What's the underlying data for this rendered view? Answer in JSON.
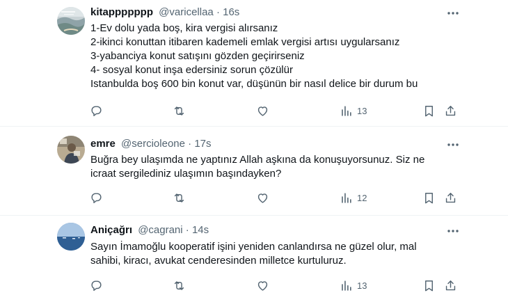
{
  "tweets": [
    {
      "name": "kitappppppp",
      "handle": "@varicellaa",
      "separator": "·",
      "time": "16s",
      "lines": [
        "1-Ev dolu yada boş, kira vergisi alırsanız",
        "2-ikinci konuttan itibaren kademeli emlak vergisi artısı uygularsanız",
        "3-yabanciya konut satışını gözden geçirirseniz",
        "4- sosyal konut inşa edersiniz sorun çözülür",
        "Istanbulda boş 600 bin konut var, düşünün bir nasıl delice bir durum bu"
      ],
      "views": "13",
      "avatar_icon": "landscape-photo-avatar"
    },
    {
      "name": "emre",
      "handle": "@sercioleone",
      "separator": "·",
      "time": "17s",
      "lines": [
        "Buğra bey ulaşımda ne yaptınız Allah aşkına da konuşuyorsunuz. Siz ne",
        "icraat sergilediniz ulaşımın başındayken?"
      ],
      "views": "12",
      "avatar_icon": "person-photo-avatar"
    },
    {
      "name": "Aniçağrı",
      "handle": "@cagrani",
      "separator": "·",
      "time": "14s",
      "lines": [
        "Sayın İmamoğlu kooperatif işini yeniden canlandırsa ne güzel olur, mal",
        "sahibi, kiracı, avukat cenderesinden milletce kurtuluruz."
      ],
      "views": "13",
      "avatar_icon": "sea-photo-avatar"
    }
  ],
  "icons": {
    "reply": "reply-icon",
    "retweet": "retweet-icon",
    "like": "like-icon",
    "views": "views-icon",
    "bookmark": "bookmark-icon",
    "share": "share-icon",
    "more": "more-icon"
  },
  "colors": {
    "text": "#0f1419",
    "secondary": "#536471",
    "divider": "#eff3f4"
  }
}
